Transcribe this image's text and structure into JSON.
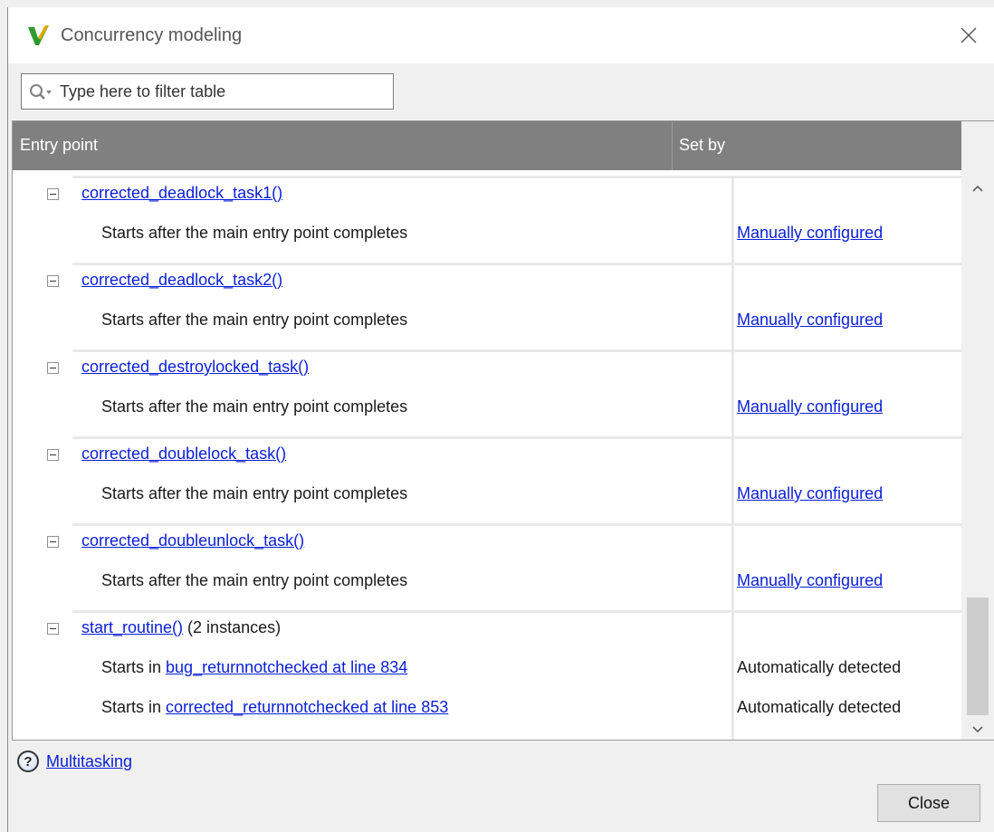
{
  "window": {
    "title": "Concurrency modeling"
  },
  "filter": {
    "placeholder": "Type here to filter table"
  },
  "table": {
    "headers": {
      "entry_point": "Entry point",
      "set_by": "Set by"
    },
    "groups": [
      {
        "entry": "corrected_deadlock_task1()",
        "suffix": "",
        "children": [
          {
            "text": "Starts after the main entry point completes",
            "link": "",
            "set_by": "Manually configured",
            "set_by_link": true
          }
        ]
      },
      {
        "entry": "corrected_deadlock_task2()",
        "suffix": "",
        "children": [
          {
            "text": "Starts after the main entry point completes",
            "link": "",
            "set_by": "Manually configured",
            "set_by_link": true
          }
        ]
      },
      {
        "entry": "corrected_destroylocked_task()",
        "suffix": "",
        "children": [
          {
            "text": "Starts after the main entry point completes",
            "link": "",
            "set_by": "Manually configured",
            "set_by_link": true
          }
        ]
      },
      {
        "entry": "corrected_doublelock_task()",
        "suffix": "",
        "children": [
          {
            "text": "Starts after the main entry point completes",
            "link": "",
            "set_by": "Manually configured",
            "set_by_link": true
          }
        ]
      },
      {
        "entry": "corrected_doubleunlock_task()",
        "suffix": "",
        "children": [
          {
            "text": "Starts after the main entry point completes",
            "link": "",
            "set_by": "Manually configured",
            "set_by_link": true
          }
        ]
      },
      {
        "entry": "start_routine()",
        "suffix": " (2 instances)",
        "children": [
          {
            "text": "Starts in ",
            "link": "bug_returnnotchecked at line 834",
            "set_by": "Automatically detected",
            "set_by_link": false
          },
          {
            "text": "Starts in ",
            "link": "corrected_returnnotchecked at line 853",
            "set_by": "Automatically detected",
            "set_by_link": false
          }
        ]
      }
    ]
  },
  "footer": {
    "help_icon_glyph": "?",
    "help_link": "Multitasking",
    "close_label": "Close"
  },
  "colors": {
    "header_bg": "#808080",
    "link": "#0a1fd8"
  },
  "icons": [
    "polyspace-logo-icon",
    "close-icon",
    "search-icon",
    "chevron-up-icon",
    "chevron-down-icon",
    "help-icon"
  ]
}
